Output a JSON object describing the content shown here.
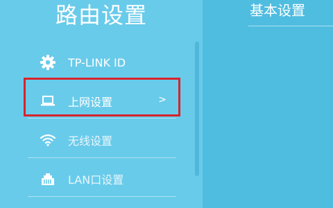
{
  "sidebar": {
    "title": "路由设置",
    "items": [
      {
        "label": "TP-LINK ID",
        "icon": "gear-icon"
      },
      {
        "label": "上网设置",
        "icon": "laptop-icon",
        "chevron": ">"
      },
      {
        "label": "无线设置",
        "icon": "wifi-icon"
      },
      {
        "label": "LAN口设置",
        "icon": "lan-port-icon"
      }
    ]
  },
  "main": {
    "section_title": "基本设置"
  },
  "colors": {
    "sidebar_bg": "#69cbea",
    "main_bg": "#4fbde0",
    "highlight": "#d8232a"
  }
}
